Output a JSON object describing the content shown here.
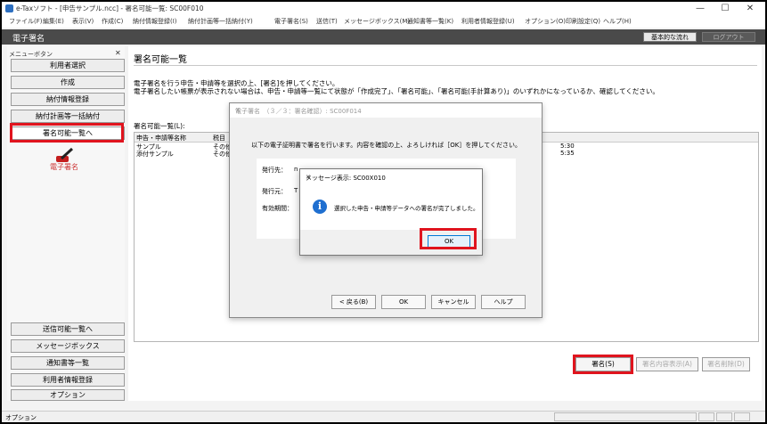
{
  "window": {
    "title": "e-Taxソフト - [申告サンプル.ncc] - 署名可能一覧: SC00F010",
    "controls": {
      "minimize": "—",
      "maximize": "☐",
      "close": "✕"
    }
  },
  "menu": [
    "ファイル(F)",
    "編集(E)",
    "表示(V)",
    "作成(C)",
    "納付情報登録(I)",
    "納付計画等一括納付(Y)",
    "電子署名(S)",
    "送信(T)",
    "メッセージボックス(M)",
    "通知書等一覧(K)",
    "利用者情報登録(U)",
    "オプション(O)",
    "印刷設定(Q)",
    "ヘルプ(H)"
  ],
  "header": {
    "title": "電子署名",
    "standard_flow_button": "基本的な流れ",
    "logout_button": "ログアウト"
  },
  "sidebar": {
    "caption": "メニューボタン",
    "close_glyph": "✕",
    "top_items": [
      "利用者選択",
      "作成",
      "納付情報登録",
      "納付計画等一括納付",
      "署名可能一覧へ"
    ],
    "active_label": "電子署名",
    "bottom_items": [
      "送信可能一覧へ",
      "メッセージボックス",
      "通知書等一覧",
      "利用者情報登録",
      "オプション"
    ]
  },
  "main": {
    "title": "署名可能一覧",
    "instructions": [
      "電子署名を行う申告・申請等を選択の上、[署名]を押してください。",
      "電子署名したい帳票が表示されない場合は、申告・申請等一覧にて状態が「作成完了」、「署名可能」、「署名可能(手計算あり)」のいずれかになっているか、確認してください。"
    ],
    "list_label": "署名可能一覧(L):",
    "columns": [
      "申告・申請等名称",
      "税目"
    ],
    "rows": [
      {
        "name": "サンプル",
        "tax": "その他",
        "time": "5:30"
      },
      {
        "name": "添付サンプル",
        "tax": "その他",
        "time": "5:35"
      }
    ]
  },
  "buttons": {
    "sign": "署名(S)",
    "sign_contents": "署名内容表示(A)",
    "sign_delete": "署名削除(D)"
  },
  "statusbar": {
    "text": "オプション"
  },
  "dialog_sign": {
    "title": "電子署名　（３／３：署名確認）: SC00F014",
    "message": "以下の電子証明書で署名を行います。内容を確認の上、よろしければ［OK］を押してください。",
    "fields": [
      {
        "label": "発行先：",
        "value": "n"
      },
      {
        "label": "発行元：",
        "value": "T"
      },
      {
        "label": "有効期間：",
        "value": ""
      }
    ],
    "buttons": {
      "back": "< 戻る(B)",
      "ok": "OK",
      "cancel": "キャンセル",
      "help": "ヘルプ"
    }
  },
  "dialog_message": {
    "title": "メッセージ表示: SC00X010",
    "close_glyph": "✕",
    "info_glyph": "i",
    "text": "選択した申告・申請等データへの署名が完了しました。",
    "ok": "OK"
  },
  "colors": {
    "highlight": "#e0141e",
    "header": "#4a4a4a",
    "info": "#1f6fd0"
  }
}
